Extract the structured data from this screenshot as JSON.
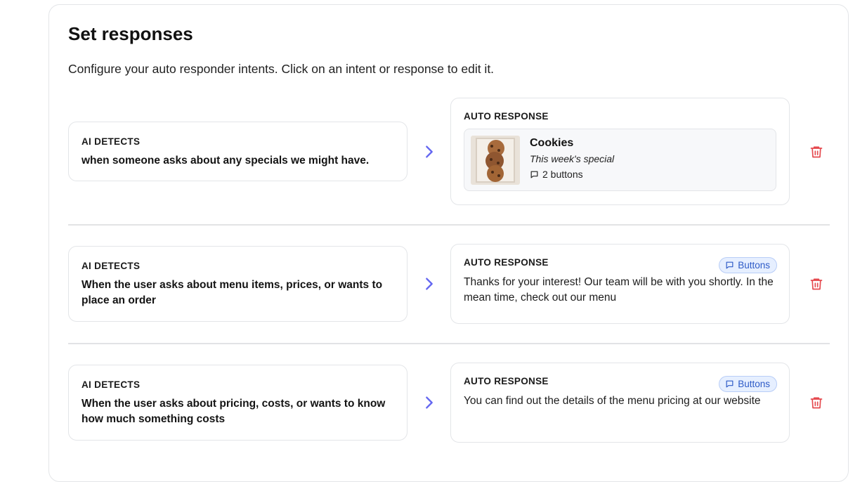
{
  "page": {
    "title": "Set responses",
    "subtitle": "Configure your auto responder intents. Click on an intent or response to edit it."
  },
  "labels": {
    "detect": "AI DETECTS",
    "response": "AUTO RESPONSE"
  },
  "intents": [
    {
      "trigger": "when someone asks about any specials we might have.",
      "response_type": "product",
      "product": {
        "name": "Cookies",
        "description": "This week's special",
        "buttons": "2 buttons"
      }
    },
    {
      "trigger": "When the user asks about menu items, prices, or wants to place an order",
      "response_type": "text",
      "badge": "Buttons",
      "response": "Thanks for your interest! Our team will be with you shortly. In the mean time, check out our menu"
    },
    {
      "trigger": "When the user asks about pricing, costs, or wants to know how much something costs",
      "response_type": "text",
      "badge": "Buttons",
      "response": "You can find out the details of the menu pricing at our website"
    }
  ],
  "icons": {
    "arrow": "chevron-right-icon",
    "delete": "trash-icon",
    "buttons": "message-square-icon"
  },
  "colors": {
    "arrow": "#6366f1",
    "delete": "#e5484d",
    "badge_bg": "#e6efff",
    "badge_text": "#2e5bc7"
  }
}
